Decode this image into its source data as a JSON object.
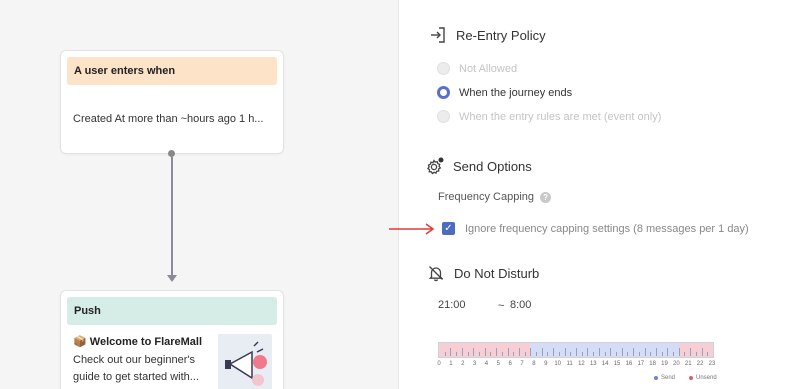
{
  "canvas": {
    "trigger_node": {
      "header": "A user enters when",
      "condition": "Created At more than ~hours ago 1 h..."
    },
    "push_node": {
      "header": "Push",
      "title_emoji": "📦",
      "title": "Welcome to FlareMall",
      "body": "Check out our beginner's guide to get started with...",
      "thumbnail_icon": "megaphone-icon"
    }
  },
  "reentry": {
    "title": "Re-Entry Policy",
    "icon": "sign-in-icon",
    "options": [
      {
        "label": "Not Allowed",
        "state": "disabled"
      },
      {
        "label": "When the journey ends",
        "state": "selected"
      },
      {
        "label": "When the entry rules are met (event only)",
        "state": "disabled"
      }
    ]
  },
  "send_options": {
    "title": "Send Options",
    "icon": "gear-icon",
    "frequency_label": "Frequency Capping",
    "help_glyph": "?",
    "ignore_label": "Ignore frequency capping settings (8 messages per 1 day)",
    "ignore_checked": true
  },
  "dnd": {
    "title": "Do Not Disturb",
    "icon": "bell-off-icon",
    "start": "21:00",
    "separator": "~",
    "end": "8:00",
    "hours": [
      "0",
      "1",
      "2",
      "3",
      "4",
      "5",
      "6",
      "7",
      "8",
      "9",
      "10",
      "11",
      "12",
      "13",
      "14",
      "15",
      "16",
      "17",
      "18",
      "19",
      "20",
      "21",
      "22",
      "23"
    ],
    "legend_send": "Send",
    "legend_unsend": "Unsend",
    "colors": {
      "send": "#d5dcf6",
      "unsend": "#f5cfd3",
      "send_dot": "#6b83d6",
      "unsend_dot": "#d6616f"
    }
  }
}
